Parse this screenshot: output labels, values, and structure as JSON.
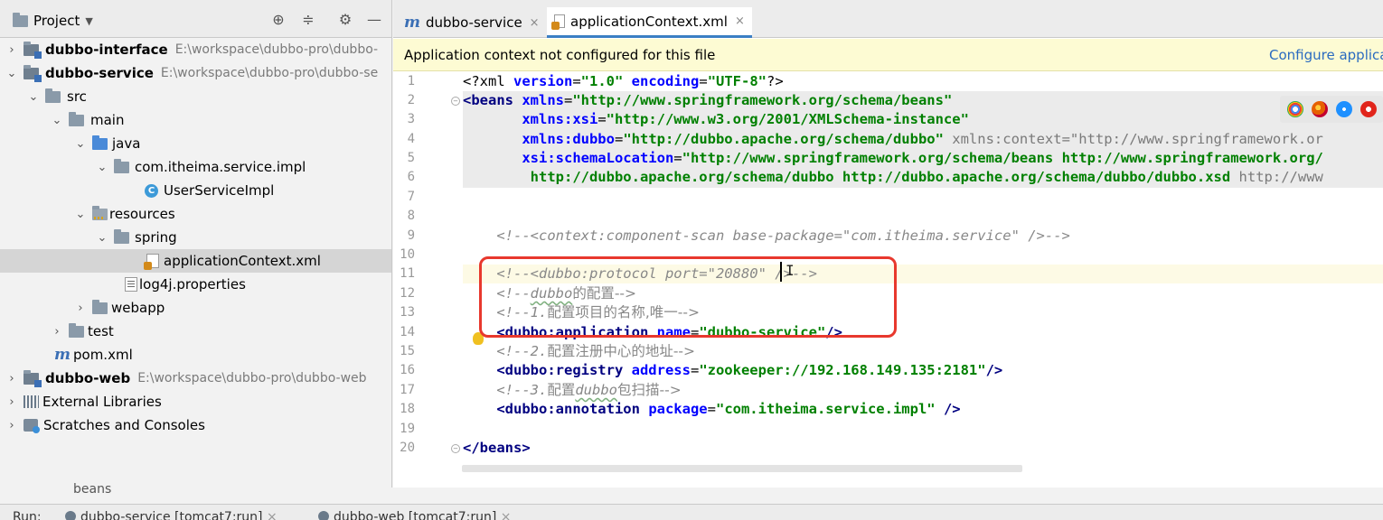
{
  "project_panel": {
    "title": "Project",
    "tree": [
      {
        "label": "dubbo-interface",
        "path": "E:\\workspace\\dubbo-pro\\dubbo-",
        "bold": true
      },
      {
        "label": "dubbo-service",
        "path": "E:\\workspace\\dubbo-pro\\dubbo-se",
        "bold": true
      },
      {
        "label": "src"
      },
      {
        "label": "main"
      },
      {
        "label": "java"
      },
      {
        "label": "com.itheima.service.impl"
      },
      {
        "label": "UserServiceImpl"
      },
      {
        "label": "resources"
      },
      {
        "label": "spring"
      },
      {
        "label": "applicationContext.xml"
      },
      {
        "label": "log4j.properties"
      },
      {
        "label": "webapp"
      },
      {
        "label": "test"
      },
      {
        "label": "pom.xml"
      },
      {
        "label": "dubbo-web",
        "path": "E:\\workspace\\dubbo-pro\\dubbo-web",
        "bold": true
      },
      {
        "label": "External Libraries"
      },
      {
        "label": "Scratches and Consoles"
      }
    ]
  },
  "editor": {
    "tabs": [
      {
        "label": "dubbo-service",
        "close": "×"
      },
      {
        "label": "applicationContext.xml",
        "close": "×"
      }
    ],
    "notice": "Application context not configured for this file",
    "notice_link": "Configure applica",
    "line_numbers": [
      "1",
      "2",
      "3",
      "4",
      "5",
      "6",
      "7",
      "8",
      "9",
      "10",
      "11",
      "12",
      "13",
      "14",
      "15",
      "16",
      "17",
      "18",
      "19",
      "20"
    ],
    "code": {
      "l1a": "<?xml ",
      "l1b": "version",
      "l1c": "=",
      "l1d": "\"1.0\"",
      "l1e": " encoding",
      "l1f": "=",
      "l1g": "\"UTF-8\"",
      "l1h": "?>",
      "l2a": "<beans ",
      "l2b": "xmlns",
      "l2c": "=",
      "l2d": "\"http://www.springframework.org/schema/beans\"",
      "l3a": "       xmlns:xsi",
      "l3b": "=",
      "l3c": "\"http://www.w3.org/2001/XMLSchema-instance\"",
      "l4a": "       xmlns:dubbo",
      "l4b": "=",
      "l4c": "\"http://dubbo.apache.org/schema/dubbo\"",
      "l4d": " xmlns:context=\"http://www.springframework.or",
      "l5a": "       xsi:schemaLocation",
      "l5b": "=",
      "l5c": "\"http://www.springframework.org/schema/beans http://www.springframework.org/",
      "l6a": "        http://dubbo.apache.org/schema/dubbo http://dubbo.apache.org/schema/dubbo/dubbo.xsd",
      "l6b": " http://www",
      "l9": "    <!--<context:component-scan base-package=\"com.itheima.service\" />-->",
      "l11": "    <!--<dubbo:protocol port=\"20880\" />-->",
      "l12a": "    <!--",
      "l12b": "dubbo",
      "l12c": "的配置-->",
      "l13a": "    <!--1.",
      "l13b": "配置项目的名称,唯一-->",
      "l14a": "    <dubbo:application ",
      "l14b": "name",
      "l14c": "=",
      "l14d": "\"dubbo-service\"",
      "l14e": "/>",
      "l15a": "    <!--2.",
      "l15b": "配置注册中心的地址-->",
      "l16a": "    <dubbo:registry ",
      "l16b": "address",
      "l16c": "=",
      "l16d": "\"zookeeper://192.168.149.135:2181\"",
      "l16e": "/>",
      "l17a": "    <!--3.",
      "l17b": "配置",
      "l17c": "dubbo",
      "l17d": "包扫描-->",
      "l18a": "    <dubbo:annotation ",
      "l18b": "package",
      "l18c": "=",
      "l18d": "\"com.itheima.service.impl\"",
      "l18e": " />",
      "l20": "</beans>"
    },
    "ibeam": "I",
    "breadcrumb": "beans"
  },
  "run_bar": {
    "run_label": "Run:",
    "configs": [
      "dubbo-service [tomcat7:run]",
      "dubbo-web [tomcat7:run]"
    ],
    "close": "×"
  },
  "colors": {
    "highlight_box": "#e8382d",
    "tab_underline": "#3b7fc4",
    "notice_bg": "#fdfbd3",
    "link": "#2a6bc0"
  }
}
